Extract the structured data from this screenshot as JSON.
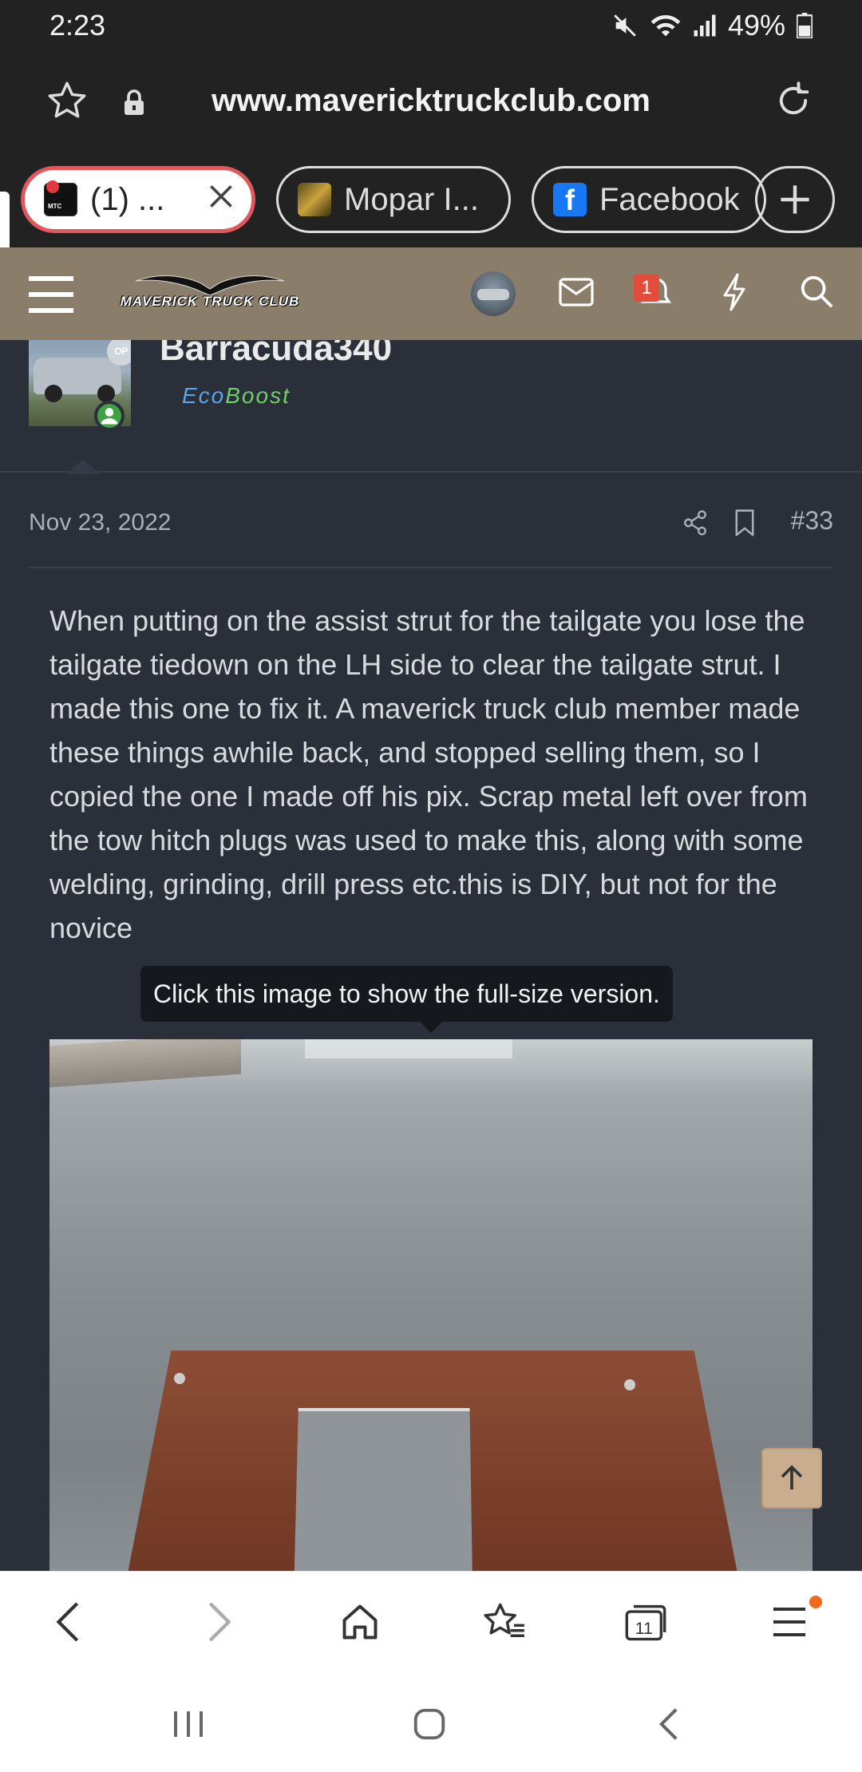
{
  "status_bar": {
    "time": "2:23",
    "battery": "49%"
  },
  "browser": {
    "url": "www.mavericktruckclub.com",
    "tabs": [
      {
        "label": "(1) ...",
        "favicon_label": "MTC",
        "active": true
      },
      {
        "label": "Mopar I...",
        "active": false
      },
      {
        "label": "Facebook",
        "active": false
      }
    ],
    "tab_count": "11"
  },
  "site": {
    "logo_text": "MAVERICK TRUCK CLUB",
    "alerts_count": "1"
  },
  "post": {
    "username": "Barracuda340",
    "user_title_part1": "Eco",
    "user_title_part2": "Boost",
    "avatar_tag": "OP",
    "date": "Nov 23, 2022",
    "number": "#33",
    "body": "When putting on the assist strut for the tailgate you lose the tailgate tiedown on the LH side to clear the tailgate strut. I made this one to fix it. A maverick truck club member made these things awhile back, and stopped selling them, so I copied the one I made off his pix. Scrap metal left over from the tow hitch plugs was used to make this, along with some welding, grinding, drill press etc.this is DIY, but not for the novice",
    "image_tooltip": "Click this image to show the full-size version."
  },
  "colors": {
    "header_bg": "#8a7e6b",
    "content_bg": "#2b2f3a",
    "badge": "#e34b3b",
    "online": "#3fa344",
    "active_tab_border": "#e0585b"
  }
}
